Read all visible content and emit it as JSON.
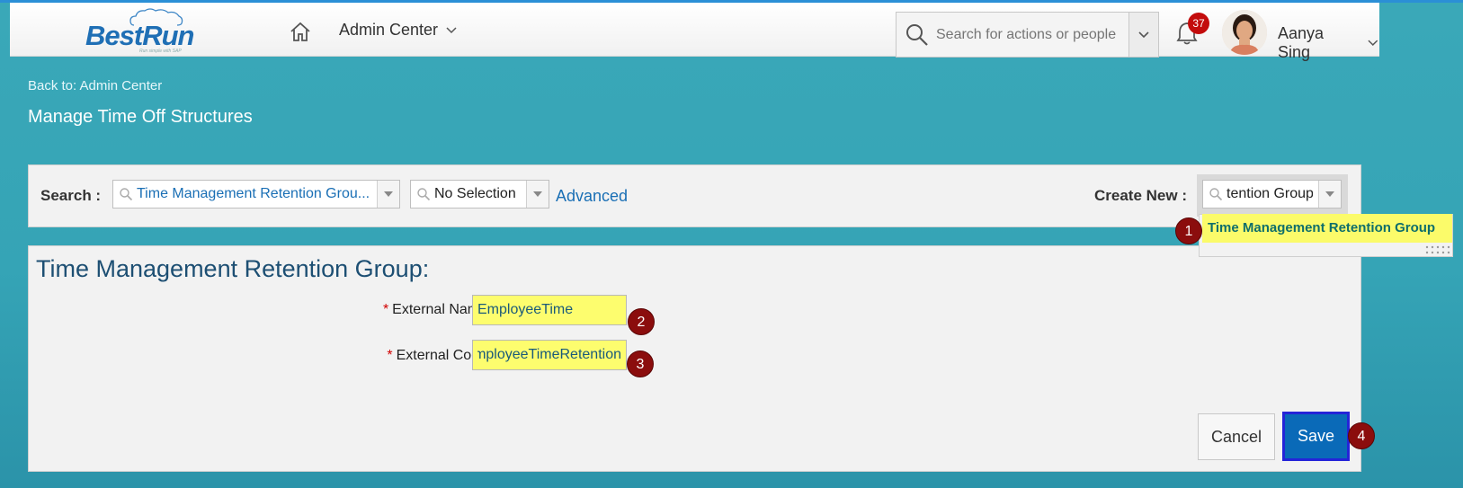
{
  "header": {
    "logo_text": "BestRun",
    "logo_tagline": "Run simple with SAP",
    "module_label": "Admin Center",
    "search_placeholder": "Search for actions or people",
    "notification_count": "37",
    "user_name": "Aanya Sing"
  },
  "page": {
    "back_link": "Back to: Admin Center",
    "title": "Manage Time Off Structures"
  },
  "search_panel": {
    "search_label": "Search :",
    "search_value": "Time Management Retention Grou...",
    "filter_value": "No Selection",
    "advanced_label": "Advanced",
    "create_new_label": "Create New :",
    "create_new_value": "tention Group"
  },
  "dropdown": {
    "option": "Time Management Retention Group"
  },
  "form": {
    "title": "Time Management Retention Group:",
    "required_marker": "*",
    "external_name_label": "External Name",
    "external_name_value": "EmployeeTime",
    "external_code_label": "External Code",
    "external_code_value": "EmployeeTimeRetention",
    "cancel_label": "Cancel",
    "save_label": "Save"
  },
  "steps": [
    "1",
    "2",
    "3",
    "4"
  ],
  "colors": {
    "step_marker": "#8b0d0d",
    "highlight": "#fbfb6a",
    "save_button": "#0a6ab8",
    "link": "#1a6fb5"
  }
}
